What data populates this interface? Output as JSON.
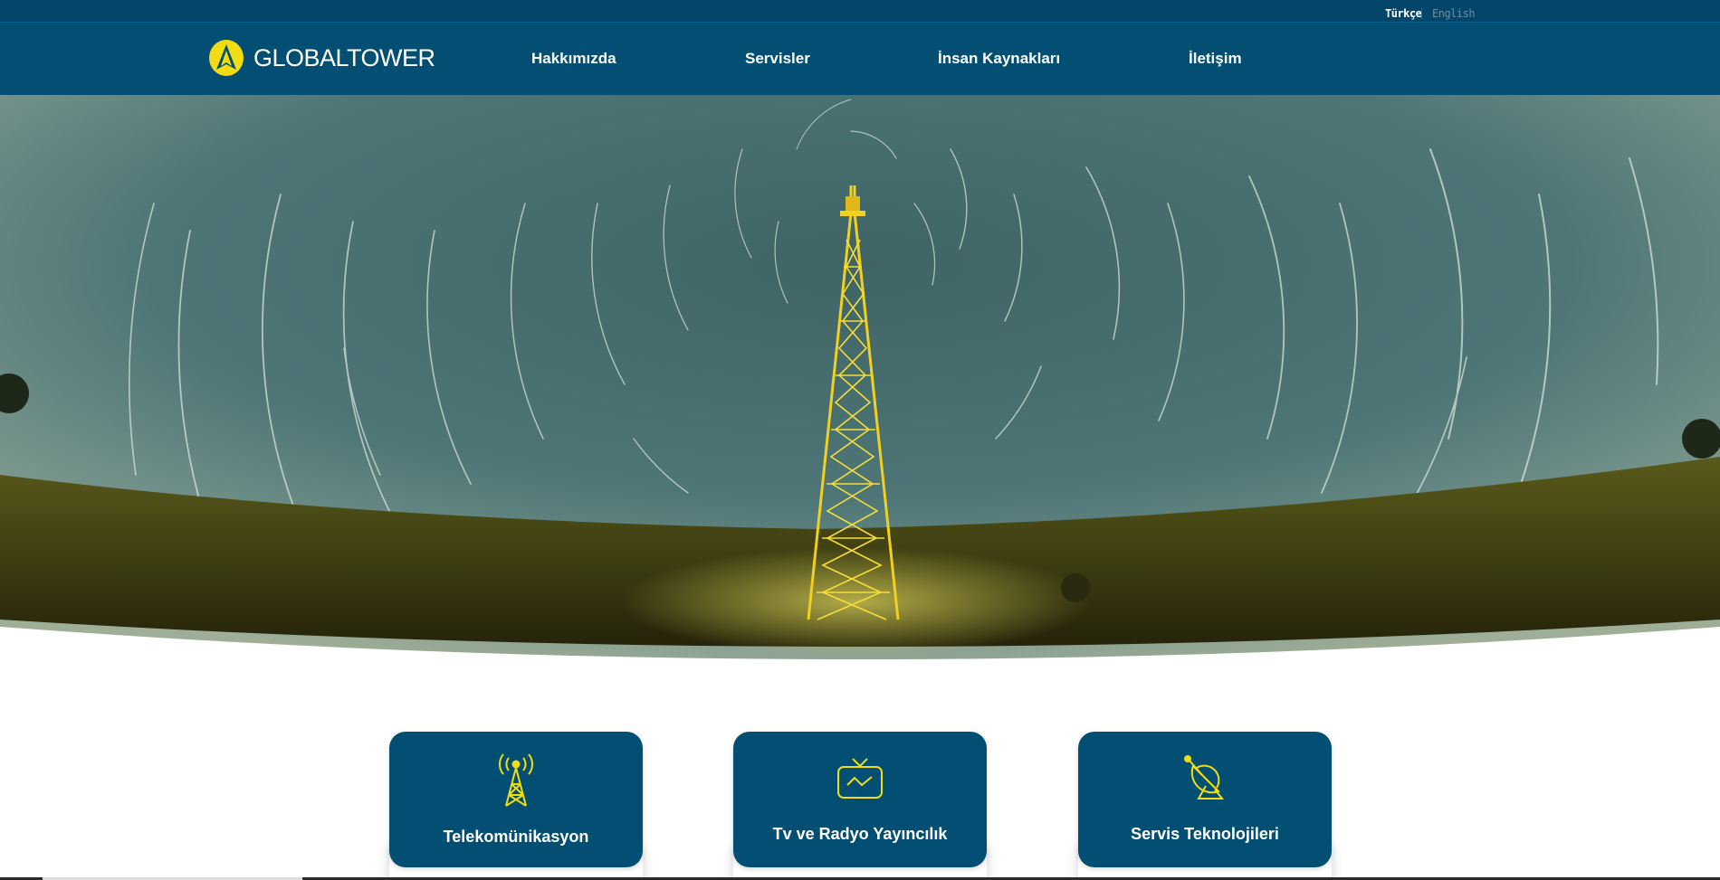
{
  "colors": {
    "brand_blue": "#034f74",
    "top_bar": "#04466a",
    "accent_yellow": "#f2dd14"
  },
  "language": {
    "active": "Türkçe",
    "inactive": "English"
  },
  "header": {
    "logo_text": "GLOBALTOWER",
    "logo_icon": "globaltower-logo-icon",
    "nav": [
      "Hakkımızda",
      "Servisler",
      "İnsan Kaynakları",
      "İletişim"
    ]
  },
  "hero": {
    "image": "star-trail-tower-photo"
  },
  "cards": [
    {
      "label": "Telekomünikasyon",
      "icon": "radio-tower-icon"
    },
    {
      "label": "Tv ve Radyo Yayıncılık",
      "icon": "tv-icon"
    },
    {
      "label": "Servis Teknolojileri",
      "icon": "satellite-dish-icon"
    }
  ]
}
